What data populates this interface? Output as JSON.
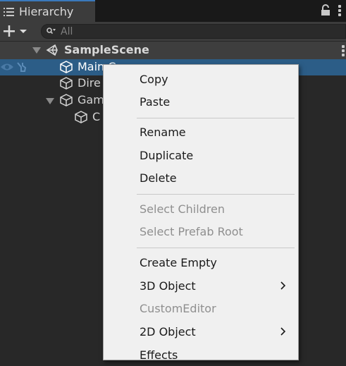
{
  "tab": {
    "label": "Hierarchy",
    "icon": "hierarchy-list-icon"
  },
  "toolbar": {
    "add_icon": "plus-dropdown-icon",
    "search_placeholder": "All",
    "search_icon": "search-filter-icon"
  },
  "tree": {
    "scene": "SampleScene",
    "items": [
      {
        "label": "Main Camera",
        "visible_text": "Main C"
      },
      {
        "label": "Directional Light",
        "visible_text": "Dire"
      },
      {
        "label": "GameObject",
        "visible_text": "Gam"
      },
      {
        "label": "Child",
        "visible_text": "C"
      }
    ]
  },
  "context_menu": {
    "items": [
      {
        "label": "Copy",
        "enabled": true
      },
      {
        "label": "Paste",
        "enabled": true
      },
      {
        "label": "Rename",
        "enabled": true
      },
      {
        "label": "Duplicate",
        "enabled": true
      },
      {
        "label": "Delete",
        "enabled": true
      },
      {
        "label": "Select Children",
        "enabled": false
      },
      {
        "label": "Select Prefab Root",
        "enabled": false
      },
      {
        "label": "Create Empty",
        "enabled": true
      },
      {
        "label": "3D Object",
        "enabled": true,
        "submenu": true
      },
      {
        "label": "CustomEditor",
        "enabled": false
      },
      {
        "label": "2D Object",
        "enabled": true,
        "submenu": true
      },
      {
        "label": "Effects",
        "enabled": true,
        "submenu": true
      }
    ]
  },
  "colors": {
    "selection": "#2c5d87",
    "tab_accent": "#3a79bb",
    "menu_bg": "#f0f0f0"
  }
}
